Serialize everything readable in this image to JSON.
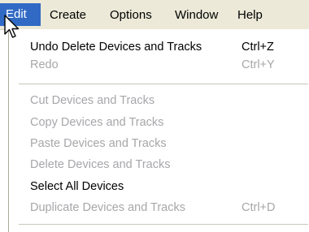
{
  "menubar": {
    "items": [
      {
        "label": "Edit"
      },
      {
        "label": "Create"
      },
      {
        "label": "Options"
      },
      {
        "label": "Window"
      },
      {
        "label": "Help"
      }
    ],
    "active_index": 0
  },
  "edit_menu": {
    "groups": [
      [
        {
          "label": "Undo Delete Devices and Tracks",
          "shortcut": "Ctrl+Z",
          "enabled": true
        },
        {
          "label": "Redo",
          "shortcut": "Ctrl+Y",
          "enabled": false
        }
      ],
      [
        {
          "label": "Cut Devices and Tracks",
          "shortcut": "",
          "enabled": false
        },
        {
          "label": "Copy Devices and Tracks",
          "shortcut": "",
          "enabled": false
        },
        {
          "label": "Paste Devices and Tracks",
          "shortcut": "",
          "enabled": false
        },
        {
          "label": "Delete Devices and Tracks",
          "shortcut": "",
          "enabled": false
        },
        {
          "label": "Select All Devices",
          "shortcut": "",
          "enabled": true
        },
        {
          "label": "Duplicate Devices and Tracks",
          "shortcut": "Ctrl+D",
          "enabled": false
        }
      ]
    ]
  },
  "cursor": {
    "icon": "mouse-pointer-icon"
  },
  "colors": {
    "menubar_bg": "#ece9d8",
    "highlight": "#316ac5",
    "disabled_text": "#a7a6aa"
  }
}
